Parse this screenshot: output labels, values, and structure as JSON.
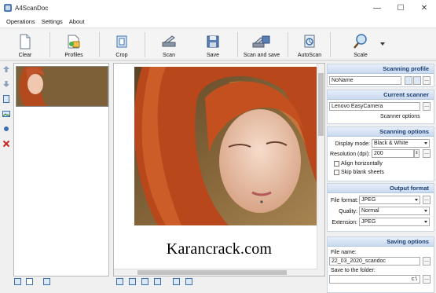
{
  "window": {
    "title": "A4ScanDoc"
  },
  "window_controls": {
    "minimize": "—",
    "maximize": "☐",
    "close": "✕"
  },
  "menu": [
    "Operations",
    "Settings",
    "About"
  ],
  "toolbar": {
    "clear": "Clear",
    "profiles": "Profiles",
    "crop": "Crop",
    "scan": "Scan",
    "save": "Save",
    "scan_and_save": "Scan and save",
    "autoscan": "AutoScan",
    "scale": "Scale"
  },
  "watermark": "Karancrack.com",
  "scanning_profile": {
    "header": "Scanning profile",
    "value": "NoName",
    "more": "..."
  },
  "current_scanner": {
    "header": "Current scanner",
    "value": "Lenovo EasyCamera",
    "more": "...",
    "options_link": "Scanner options"
  },
  "scanning_options": {
    "header": "Scanning options",
    "display_mode_label": "Display mode:",
    "display_mode_value": "Black & White",
    "resolution_label": "Resolution (dpi):",
    "resolution_value": "200",
    "more": "...",
    "align_horizontally": "Align horizontally",
    "skip_blank_sheets": "Skip blank sheets"
  },
  "output_format": {
    "header": "Output format",
    "file_format_label": "File format:",
    "file_format_value": "JPEG",
    "quality_label": "Quality:",
    "quality_value": "Normal",
    "extension_label": "Extension:",
    "extension_value": "JPEG",
    "more": "..."
  },
  "saving_options": {
    "header": "Saving options",
    "file_name_label": "File name:",
    "file_name_value": "22_03_2020_scandoc",
    "more": "...",
    "folder_label": "Save to the folder:",
    "folder_value": "c:\\",
    "folder_more": "..."
  },
  "colors": {
    "accent": "#1d3f74",
    "section_header": "#c9d9ef",
    "hair": "#c0532a"
  }
}
